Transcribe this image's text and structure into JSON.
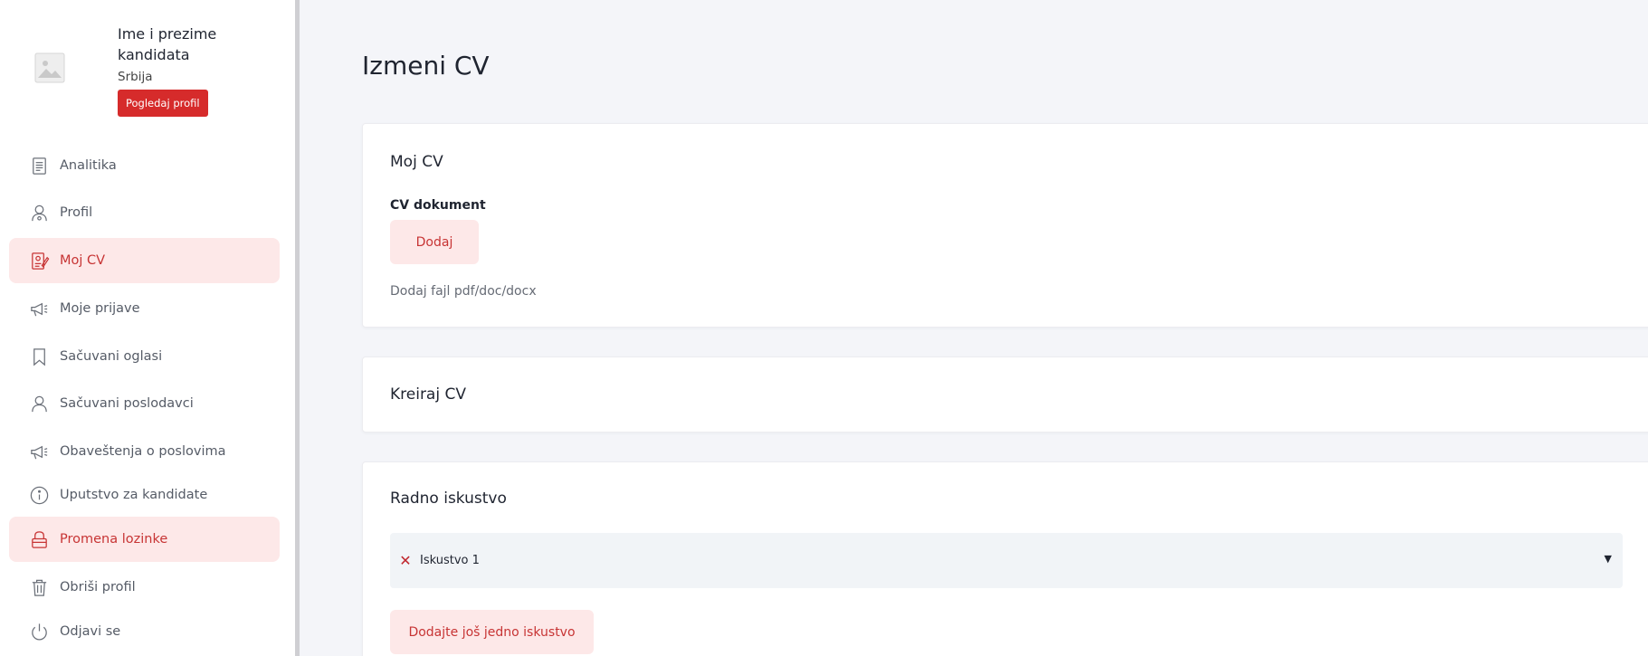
{
  "sidebar": {
    "profile": {
      "name": "Ime i prezime kandidata",
      "country": "Srbija",
      "view_profile_label": "Pogledaj profil",
      "avatar_icon": "image-placeholder-icon"
    },
    "items": [
      {
        "label": "Analitika",
        "icon": "document-icon"
      },
      {
        "label": "Profil",
        "icon": "user-icon"
      },
      {
        "label": "Moj CV",
        "icon": "cv-edit-icon"
      },
      {
        "label": "Moje prijave",
        "icon": "megaphone-icon"
      },
      {
        "label": "Sačuvani oglasi",
        "icon": "bookmark-icon"
      },
      {
        "label": "Sačuvani poslodavci",
        "icon": "person-icon"
      },
      {
        "label": "Obaveštenja o poslovima",
        "icon": "megaphone-icon"
      },
      {
        "label": "Uputstvo za kandidate",
        "icon": "info-icon"
      },
      {
        "label": "Promena lozinke",
        "icon": "lock-icon"
      },
      {
        "label": "Obriši profil",
        "icon": "trash-icon"
      },
      {
        "label": "Odjavi se",
        "icon": "power-icon"
      }
    ],
    "active_items": [
      "Moj CV",
      "Promena lozinke"
    ]
  },
  "main": {
    "title": "Izmeni CV",
    "my_cv": {
      "title": "Moj CV",
      "document_label": "CV dokument",
      "add_button": "Dodaj",
      "hint": "Dodaj fajl pdf/doc/docx"
    },
    "create_cv": {
      "title": "Kreiraj CV"
    },
    "experience": {
      "title": "Radno iskustvo",
      "entries": [
        {
          "label": "Iskustvo 1"
        }
      ],
      "add_another_button": "Dodajte još jedno iskustvo"
    }
  },
  "colors": {
    "accent": "#d62b2b",
    "accent_text": "#c73434",
    "active_bg": "#fde8e8",
    "page_bg": "#f4f5f9"
  }
}
